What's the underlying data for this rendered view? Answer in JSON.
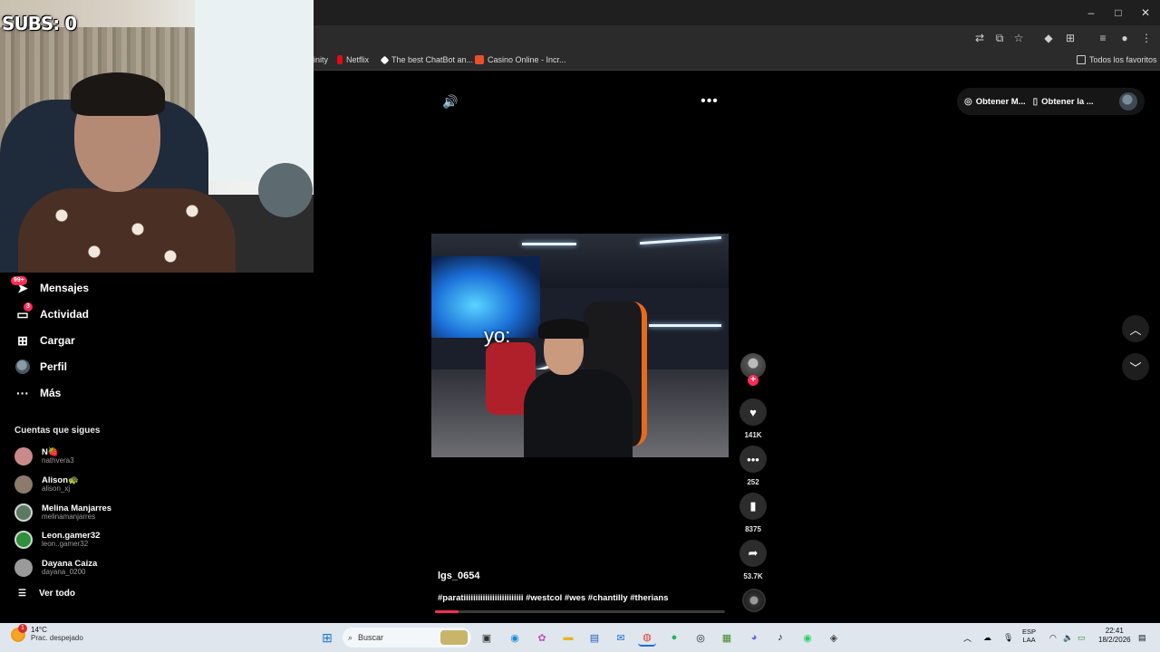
{
  "overlay": {
    "subs_label": "SUBS: 0"
  },
  "bookmarks": [
    {
      "label": "inity",
      "color": "#777777"
    },
    {
      "label": "Netflix",
      "color": "#e50914"
    },
    {
      "label": "The best ChatBot an...",
      "color": "#ffffff"
    },
    {
      "label": "Casino Online - Incr...",
      "color": "#e8502a"
    }
  ],
  "bookmarks_all": "Todos los favoritos",
  "window_controls": {
    "minimize": "–",
    "maximize": "□",
    "close": "✕"
  },
  "sidebar": {
    "nav": [
      {
        "label": "Mensajes",
        "icon": "send-icon",
        "badge": "99+"
      },
      {
        "label": "Actividad",
        "icon": "activity-icon",
        "badge": "3"
      },
      {
        "label": "Cargar",
        "icon": "upload-icon",
        "badge": ""
      },
      {
        "label": "Perfil",
        "icon": "profile-avatar-icon",
        "badge": ""
      },
      {
        "label": "Más",
        "icon": "more-icon",
        "badge": ""
      }
    ],
    "following_title": "Cuentas que sigues",
    "accounts": [
      {
        "name": "N🍓",
        "username": "nathvera3",
        "color": "#c98a8a"
      },
      {
        "name": "Alison🐢",
        "username": "alison_xj",
        "color": "#8c7a6c"
      },
      {
        "name": "Melina Manjarres",
        "username": "melinamanjarres",
        "color": "#5c7a62"
      },
      {
        "name": "Leon.gamer32",
        "username": "leon..gamer32",
        "color": "#2f8f3a"
      },
      {
        "name": "Dayana Caiza",
        "username": "dayana_0200",
        "color": "#9a9a9a"
      }
    ],
    "see_all": "Ver todo"
  },
  "video": {
    "caption_overlay": "yo:",
    "author": "lgs_0654",
    "description": "#paratiiiiiiiiiiiiiiiiiiiiiiiii #westcol #wes #chantilly #therians",
    "progress": 0.08
  },
  "actions": {
    "likes": "141K",
    "comments": "252",
    "saves": "8375",
    "shares": "53.7K"
  },
  "top_bar": {
    "get_coins": "Obtener M...",
    "get_app": "Obtener la ..."
  },
  "taskbar": {
    "temperature": "14°C",
    "weather_desc": "Prac. despejado",
    "weather_badge": "1",
    "search_placeholder": "Buscar",
    "lang_top": "ESP",
    "lang_bottom": "LAA",
    "time": "22:41",
    "date": "18/2/2026"
  }
}
